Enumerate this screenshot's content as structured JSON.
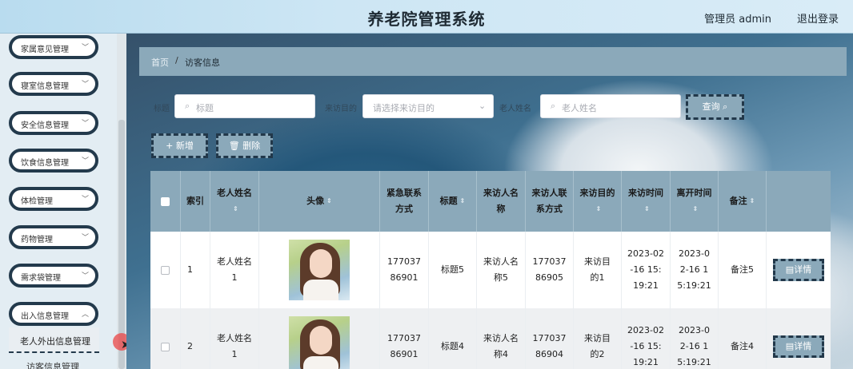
{
  "header": {
    "title": "养老院管理系统",
    "user": "管理员 admin",
    "logout": "退出登录"
  },
  "sidebar": {
    "items": [
      {
        "label": "家属意见管理"
      },
      {
        "label": "寝室信息管理"
      },
      {
        "label": "安全信息管理"
      },
      {
        "label": "饮食信息管理"
      },
      {
        "label": "体检管理"
      },
      {
        "label": "药物管理"
      },
      {
        "label": "需求袋管理"
      },
      {
        "label": "出入信息管理"
      }
    ],
    "active_sub": "老人外出信息管理",
    "next_sub": "访客信息管理"
  },
  "breadcrumb": {
    "home": "首页",
    "sep": "/",
    "current": "访客信息"
  },
  "search": {
    "title_placeholder": "标题",
    "purpose_placeholder": "请选择来访目的",
    "name_placeholder": "老人姓名",
    "query_label": "查询",
    "label_left": "标题",
    "label_mid": "来访目的",
    "label_right": "老人姓名"
  },
  "actions": {
    "add_label": "+ 新增",
    "delete_label": "删除"
  },
  "table": {
    "headers": [
      "索引",
      "老人姓名",
      "头像",
      "紧急联系方式",
      "标题",
      "来访人名称",
      "来访人联系方式",
      "来访目的",
      "来访时间",
      "离开时间",
      "备注"
    ],
    "detail_label": "详情",
    "rows": [
      {
        "index": "1",
        "name": "老人姓名1",
        "phone": "17703786901",
        "title": "标题5",
        "visitor": "来访人名称5",
        "visitor_phone": "17703786905",
        "purpose": "来访目的1",
        "visit_time": "2023-02-16 15:19:21",
        "leave_time": "2023-02-16 15:19:21",
        "remark": "备注5"
      },
      {
        "index": "2",
        "name": "老人姓名1",
        "phone": "17703786901",
        "title": "标题4",
        "visitor": "来访人名称4",
        "visitor_phone": "17703786904",
        "purpose": "来访目的2",
        "visit_time": "2023-02-16 15:19:21",
        "leave_time": "2023-02-16 15:19:21",
        "remark": "备注4"
      }
    ]
  }
}
